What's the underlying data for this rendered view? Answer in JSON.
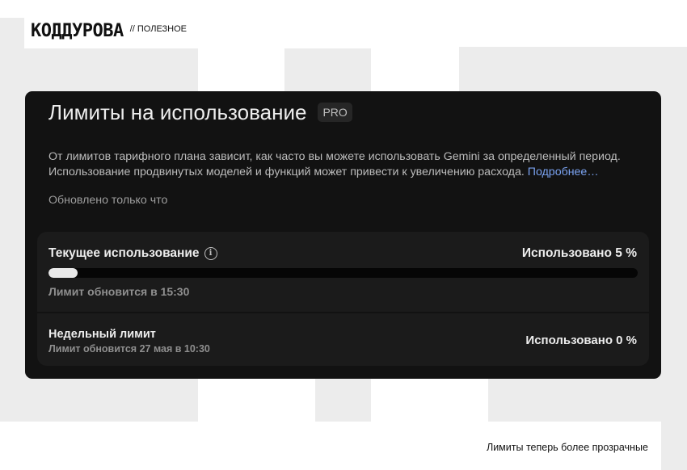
{
  "brand": {
    "logo": "КОДДУРОВА",
    "section_tag": "// ПОЛЕЗНОЕ"
  },
  "dialog": {
    "title": "Лимиты на использование",
    "badge": "PRO",
    "description": "От лимитов тарифного плана зависит, как часто вы можете использовать Gemini за определенный период. Использование продвинутых моделей и функций может привести к увеличению расхода.",
    "more_link": "Подробнее…",
    "updated": "Обновлено только что"
  },
  "current_usage": {
    "label": "Текущее использование",
    "info_icon": "info-icon",
    "used_text": "Использовано 5 %",
    "used_fraction": 0.05,
    "reset_text": "Лимит обновится в 15:30"
  },
  "weekly_limit": {
    "label": "Недельный лимит",
    "reset_text": "Лимит обновится 27 мая в 10:30",
    "used_text": "Использовано 0 %",
    "used_fraction": 0.0
  },
  "caption": "Лимиты теперь более прозрачные",
  "colors": {
    "card_bg": "#121212",
    "panel_bg": "#1b1b1b",
    "link": "#7aa2f0",
    "progress_fill": "#e8e8e8",
    "progress_track": "#060606"
  }
}
